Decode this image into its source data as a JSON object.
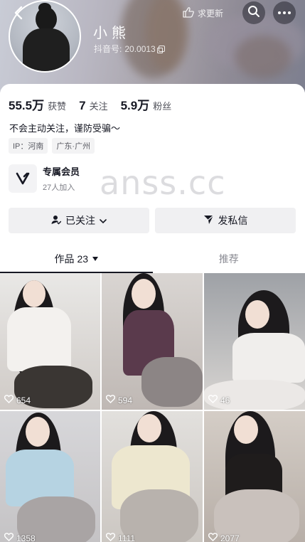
{
  "header": {
    "nickname": "小熊",
    "douyin_id_label": "抖音号:",
    "douyin_id": "20.0013",
    "update_label": "求更新"
  },
  "stats": [
    {
      "value": "55.5万",
      "label": "获赞"
    },
    {
      "value": "7",
      "label": "关注"
    },
    {
      "value": "5.9万",
      "label": "粉丝"
    }
  ],
  "signature": "不会主动关注，谨防受骗～",
  "tags": [
    "IP：河南",
    "广东·广州"
  ],
  "member": {
    "title": "专属会员",
    "subtitle": "27人加入"
  },
  "watermark": "anss.cc",
  "buttons": {
    "followed": "已关注",
    "message": "发私信"
  },
  "tabs": [
    {
      "label": "作品",
      "count": "23"
    },
    {
      "label": "推荐"
    }
  ],
  "videos": [
    {
      "likes": "654"
    },
    {
      "likes": "594"
    },
    {
      "likes": "46"
    },
    {
      "likes": "1358"
    },
    {
      "likes": "1111"
    },
    {
      "likes": "2077"
    }
  ]
}
